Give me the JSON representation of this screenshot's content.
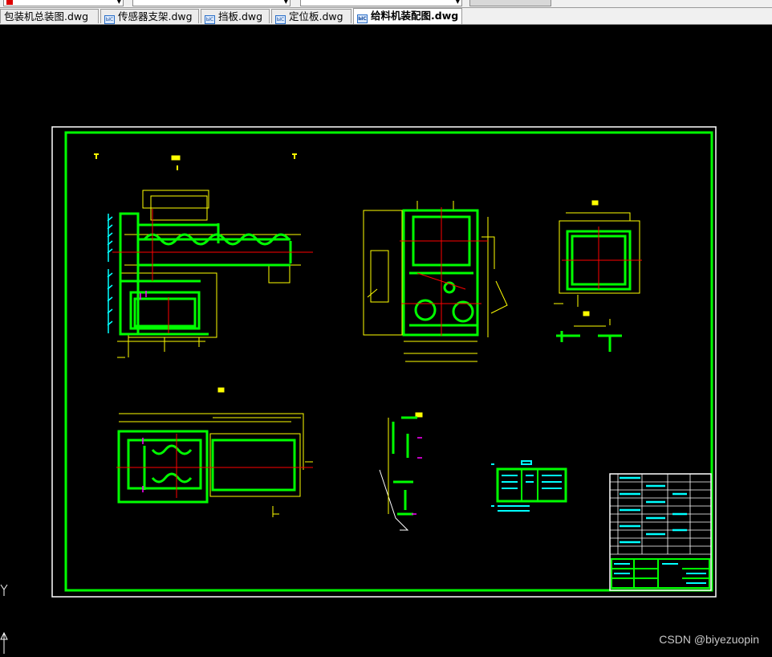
{
  "toolbar": {
    "combos": [
      "",
      "",
      "",
      ""
    ]
  },
  "tabs": [
    {
      "label": "包装机总装图.dwg",
      "icon": "dwg-file-icon",
      "active": false
    },
    {
      "label": "传感器支架.dwg",
      "icon": "dwg-file-icon",
      "active": false
    },
    {
      "label": "挡板.dwg",
      "icon": "dwg-file-icon",
      "active": false
    },
    {
      "label": "定位板.dwg",
      "icon": "dwg-file-icon",
      "active": false
    },
    {
      "label": "给料机装配图.dwg",
      "icon": "dwg-file-icon",
      "active": true
    }
  ],
  "watermark": "CSDN @biyezuopin",
  "colors": {
    "background": "#000000",
    "green": "#00ff00",
    "yellow": "#ffff00",
    "cyan": "#00ffff",
    "red": "#ff0000",
    "magenta": "#ff00ff",
    "white": "#ffffff"
  }
}
